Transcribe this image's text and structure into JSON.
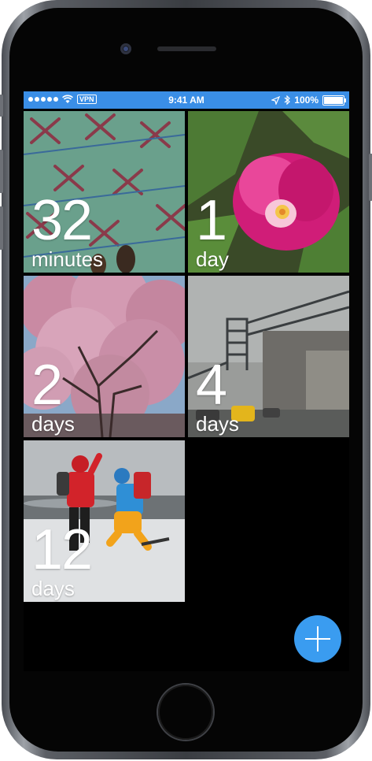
{
  "status_bar": {
    "vpn_label": "VPN",
    "time": "9:41 AM",
    "battery_text": "100%"
  },
  "tiles": [
    {
      "count": "32",
      "unit": "minutes",
      "image": "green-patterned-carpet-photo"
    },
    {
      "count": "1",
      "unit": "day",
      "image": "pink-tulip-photo"
    },
    {
      "count": "2",
      "unit": "days",
      "image": "cherry-blossom-tree-photo"
    },
    {
      "count": "4",
      "unit": "days",
      "image": "bridge-street-photo"
    },
    {
      "count": "12",
      "unit": "days",
      "image": "jumping-hikers-snow-photo"
    }
  ],
  "fab": {
    "icon": "plus-icon"
  },
  "colors": {
    "accent": "#3a9cf0",
    "status_bar": "#3a8ee6",
    "background": "#000000"
  }
}
